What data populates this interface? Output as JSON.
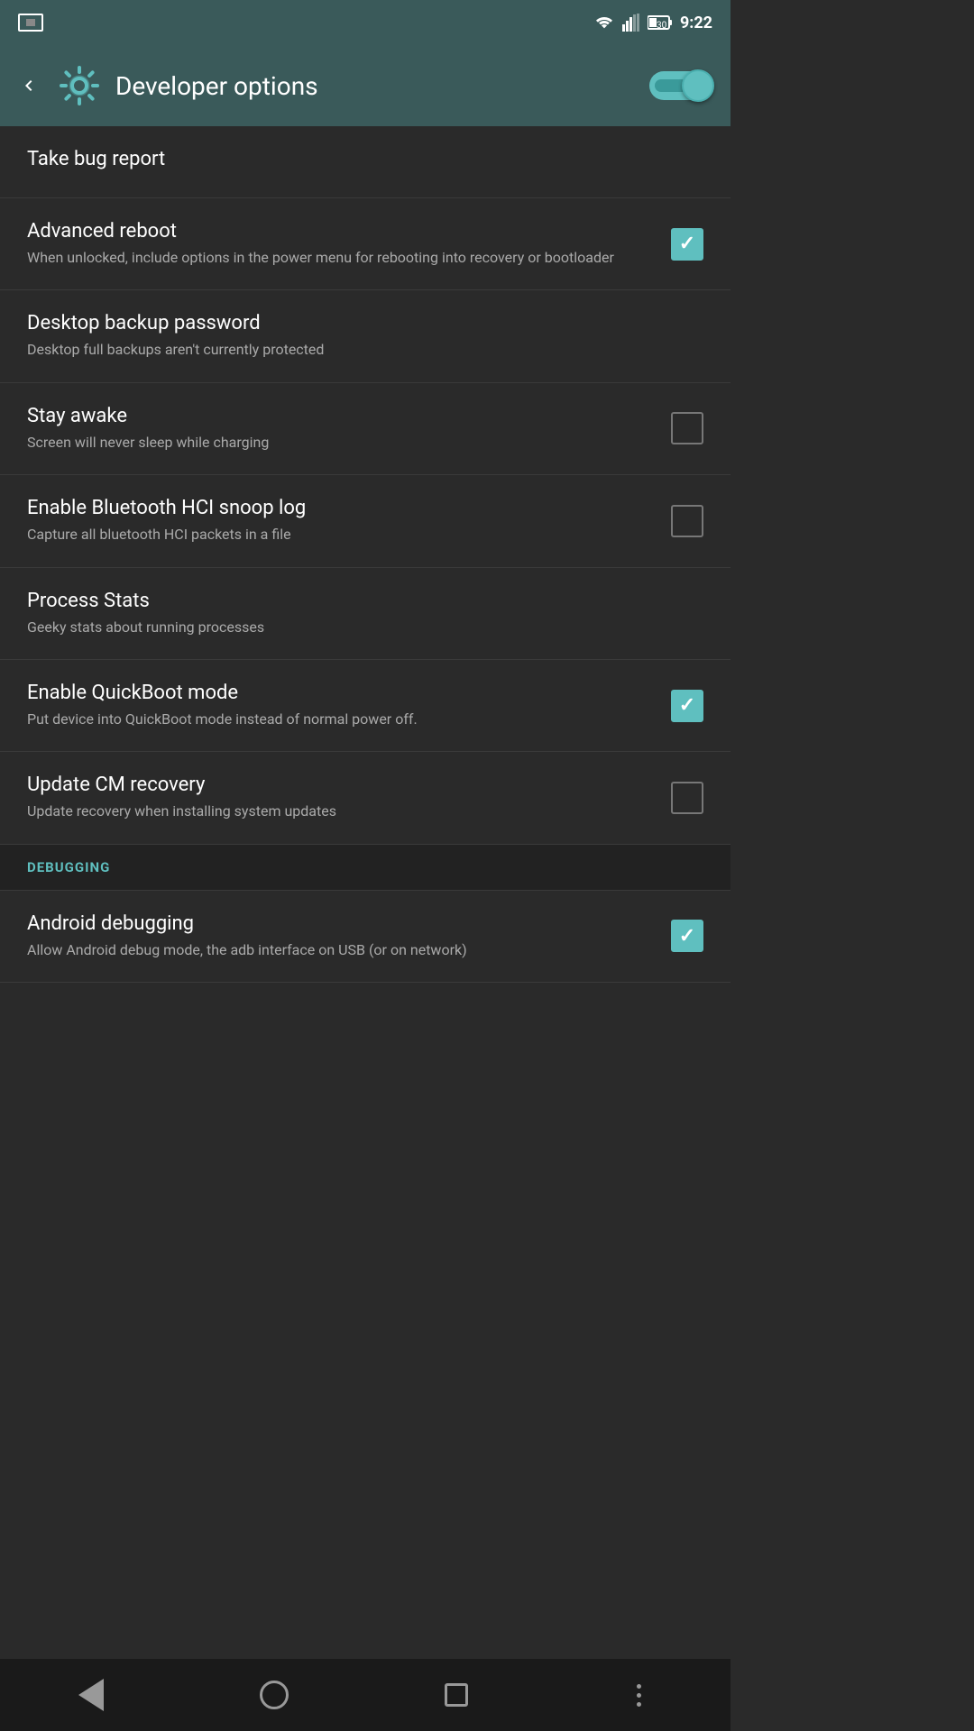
{
  "statusBar": {
    "time": "9:22",
    "batteryLevel": "30"
  },
  "header": {
    "title": "Developer options",
    "toggle": {
      "enabled": true
    }
  },
  "settings": [
    {
      "id": "take-bug-report",
      "title": "Take bug report",
      "subtitle": "",
      "hasCheckbox": false,
      "checked": false
    },
    {
      "id": "advanced-reboot",
      "title": "Advanced reboot",
      "subtitle": "When unlocked, include options in the power menu for rebooting into recovery or bootloader",
      "hasCheckbox": true,
      "checked": true
    },
    {
      "id": "desktop-backup-password",
      "title": "Desktop backup password",
      "subtitle": "Desktop full backups aren't currently protected",
      "hasCheckbox": false,
      "checked": false
    },
    {
      "id": "stay-awake",
      "title": "Stay awake",
      "subtitle": "Screen will never sleep while charging",
      "hasCheckbox": true,
      "checked": false
    },
    {
      "id": "enable-bluetooth-hci",
      "title": "Enable Bluetooth HCI snoop log",
      "subtitle": "Capture all bluetooth HCI packets in a file",
      "hasCheckbox": true,
      "checked": false
    },
    {
      "id": "process-stats",
      "title": "Process Stats",
      "subtitle": "Geeky stats about running processes",
      "hasCheckbox": false,
      "checked": false
    },
    {
      "id": "enable-quickboot",
      "title": "Enable QuickBoot mode",
      "subtitle": "Put device into QuickBoot mode instead of normal power off.",
      "hasCheckbox": true,
      "checked": true
    },
    {
      "id": "update-cm-recovery",
      "title": "Update CM recovery",
      "subtitle": "Update recovery when installing system updates",
      "hasCheckbox": true,
      "checked": false
    }
  ],
  "sections": [
    {
      "id": "debugging",
      "title": "DEBUGGING",
      "items": [
        {
          "id": "android-debugging",
          "title": "Android debugging",
          "subtitle": "Allow Android debug mode, the adb interface on USB (or on network)",
          "hasCheckbox": true,
          "checked": true
        }
      ]
    }
  ],
  "navBar": {
    "back": "back-button",
    "home": "home-button",
    "recent": "recent-apps-button",
    "more": "more-options-button"
  }
}
